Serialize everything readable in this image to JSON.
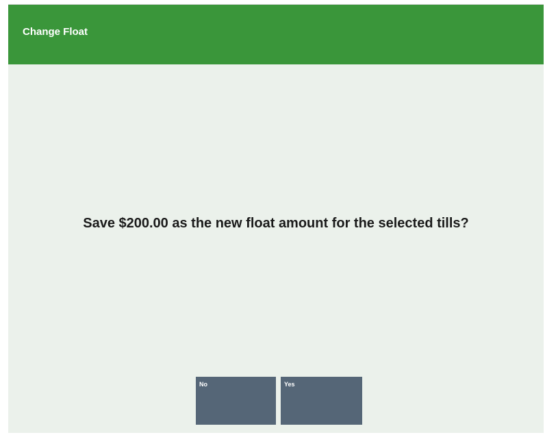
{
  "header": {
    "title": "Change Float"
  },
  "dialog": {
    "message": "Save $200.00 as the new float amount for the selected tills?"
  },
  "buttons": {
    "no_label": "No",
    "yes_label": "Yes"
  },
  "colors": {
    "header_background": "#3a963a",
    "body_background": "#ebf1eb",
    "button_background": "#556677"
  }
}
